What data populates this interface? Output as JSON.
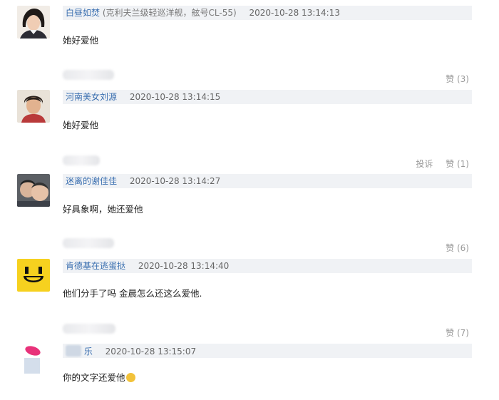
{
  "comments": [
    {
      "username": "白昼如焚",
      "extra": "(克利夫兰级轻巡洋舰，舷号CL-55)",
      "time": "2020-10-28 13:14:13",
      "content": "她好爱他",
      "like_label": "赞 (3)",
      "report_label": ""
    },
    {
      "username": "河南美女刘源",
      "extra": "",
      "time": "2020-10-28 13:14:15",
      "content": "她好爱他",
      "like_label": "赞 (1)",
      "report_label": "投诉"
    },
    {
      "username": "迷离的谢佳佳",
      "extra": "",
      "time": "2020-10-28 13:14:27",
      "content": "好具象啊，她还爱他",
      "like_label": "赞 (6)",
      "report_label": ""
    },
    {
      "username": "肯德基在逃蛋挞",
      "extra": "",
      "time": "2020-10-28 13:14:40",
      "content": "他们分手了吗 金晨怎么还这么爱他.",
      "like_label": "赞 (7)",
      "report_label": ""
    },
    {
      "username": "乐",
      "extra": "",
      "time": "2020-10-28 13:15:07",
      "content": "你的文字还爱他",
      "like_label": "",
      "report_label": ""
    }
  ],
  "colors": {
    "username": "#3a6fb0",
    "meta_bar": "#f0f2f5",
    "action_text": "#999999"
  }
}
